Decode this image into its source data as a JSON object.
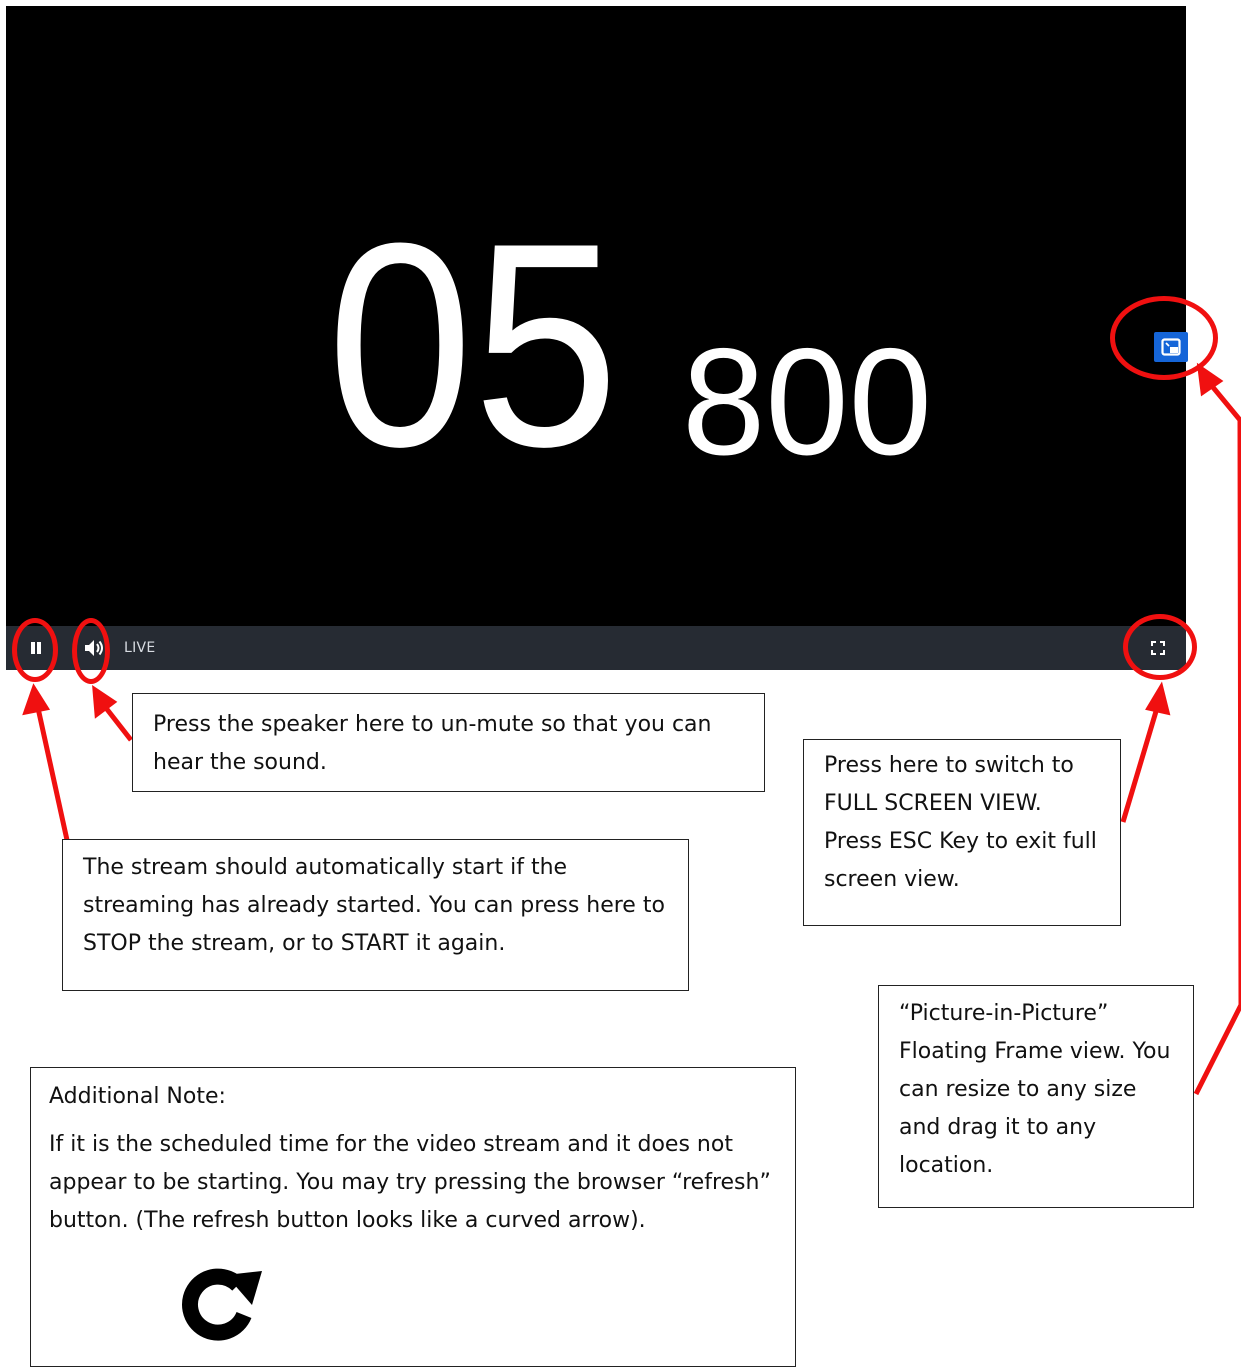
{
  "player": {
    "timer_main": "05",
    "timer_sub": "800",
    "live_label": "LIVE",
    "accent_pip": "#1565d8",
    "controlbar_color": "#262b33",
    "icons": {
      "pause": "pause-icon",
      "volume": "volume-icon",
      "fullscreen": "fullscreen-icon",
      "pip": "picture-in-picture-icon"
    }
  },
  "annotations": {
    "color": "#f01010",
    "speaker": "Press the speaker here to un-mute so that you can hear the sound.",
    "fullscreen": "Press here to switch to FULL SCREEN VIEW. Press ESC Key to exit full screen view.",
    "pause": "The stream should automatically start if the streaming has already started.  You can press here to STOP the stream, or to START it again.",
    "pip": "“Picture-in-Picture” Floating Frame view. You can resize to any size and drag it to any location.",
    "note_heading": "Additional Note:",
    "note_body": "If it is the scheduled time for the video stream and it does not appear to be starting.  You may try pressing the browser “refresh” button.  (The refresh button looks like a curved arrow).",
    "refresh_icon": "refresh-icon"
  }
}
